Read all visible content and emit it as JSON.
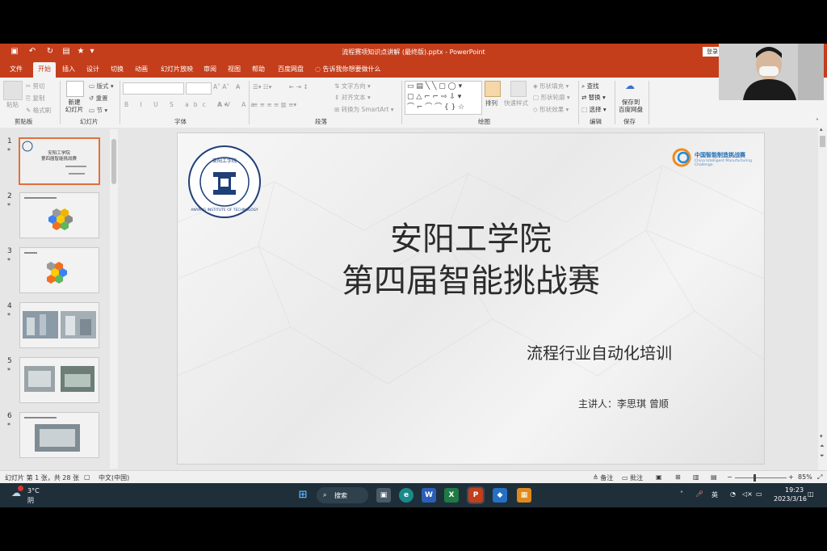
{
  "window": {
    "title": "流程赛项知识点讲解 (最终版).pptx  -  PowerPoint",
    "login": "登录"
  },
  "menu": [
    "文件",
    "开始",
    "插入",
    "设计",
    "切换",
    "动画",
    "幻灯片放映",
    "审阅",
    "视图",
    "帮助",
    "百度网盘"
  ],
  "tell_me": "告诉我你想要做什么",
  "ribbon": {
    "clipboard": {
      "paste": "粘贴",
      "cut": "剪切",
      "copy": "复制",
      "format_painter": "格式刷",
      "group": "剪贴板"
    },
    "slides": {
      "new_slide": "新建\n幻灯片",
      "layout": "版式",
      "reset": "重置",
      "section": "节",
      "group": "幻灯片"
    },
    "font": {
      "group": "字体"
    },
    "paragraph": {
      "text_direction": "文字方向",
      "align_text": "对齐文本",
      "smartart": "转换为 SmartArt",
      "group": "段落"
    },
    "drawing": {
      "arrange": "排列",
      "quick_styles": "快速样式",
      "shape_fill": "形状填充",
      "shape_outline": "形状轮廓",
      "shape_effects": "形状效果",
      "group": "绘图"
    },
    "editing": {
      "find": "查找",
      "replace": "替换",
      "select": "选择",
      "group": "编辑"
    },
    "save": {
      "save_baidu": "保存到\n百度网盘",
      "group": "保存"
    }
  },
  "thumbnails": [
    {
      "num": "1",
      "title": "安阳工学院\n第四届智能挑战赛"
    },
    {
      "num": "2"
    },
    {
      "num": "3"
    },
    {
      "num": "4"
    },
    {
      "num": "5"
    },
    {
      "num": "6"
    }
  ],
  "slide": {
    "logo_text": "ANYANG INSTITUTE OF TECHNOLOGY",
    "logo_chars": "安阳工学院",
    "brand": "中国智能制造挑战赛",
    "brand_sub": "China Intelligent Manufacturing Challenge",
    "title_line1": "安阳工学院",
    "title_line2": "第四届智能挑战赛",
    "subtitle": "流程行业自动化培训",
    "presenter": "主讲人：李思琪  曾顺"
  },
  "status": {
    "slide_info": "幻灯片 第 1 张，共 28 张",
    "language": "中文(中国)",
    "notes": "备注",
    "comments": "批注",
    "zoom": "85%"
  },
  "taskbar": {
    "weather_temp": "3°C",
    "weather_desc": "阴",
    "search": "搜索",
    "ime": "英",
    "time": "19:23",
    "date": "2023/3/16"
  },
  "colors": {
    "accent": "#c43e1c",
    "taskbar": "#1f2f3a"
  }
}
